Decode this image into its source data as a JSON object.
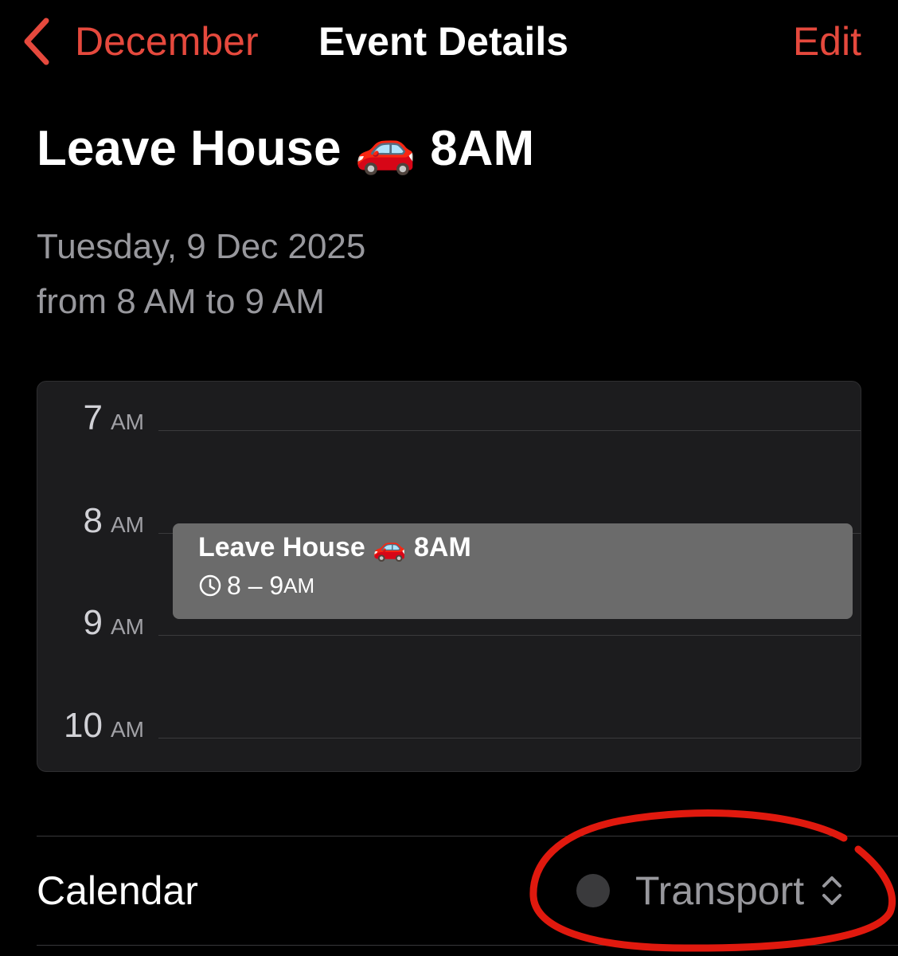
{
  "nav": {
    "back_label": "December",
    "title": "Event Details",
    "edit_label": "Edit"
  },
  "event": {
    "title": "Leave House 🚗 8AM",
    "title_parts": [
      "Leave House",
      "🚗",
      "8AM"
    ],
    "date": "Tuesday, 9 Dec 2025",
    "time": "from 8 AM to 9 AM"
  },
  "dayview": {
    "hours": [
      {
        "num": "7",
        "ampm": "AM"
      },
      {
        "num": "8",
        "ampm": "AM"
      },
      {
        "num": "9",
        "ampm": "AM"
      },
      {
        "num": "10",
        "ampm": "AM"
      }
    ],
    "event_block": {
      "title_parts": [
        "Leave House",
        "🚗",
        "8AM"
      ],
      "time_range": "8 – 9",
      "time_suffix": "AM"
    }
  },
  "calendar_row": {
    "label": "Calendar",
    "value": "Transport"
  },
  "colors": {
    "accent": "#e5493d",
    "background": "#000000",
    "secondary_text": "#98989d",
    "card_background": "#1c1c1e",
    "event_block": "#6b6b6b",
    "annotation_circle": "#e0190e"
  },
  "icons": [
    "back-chevron-icon",
    "car-icon",
    "clock-icon",
    "calendar-color-dot",
    "up-down-chevron-icon"
  ]
}
